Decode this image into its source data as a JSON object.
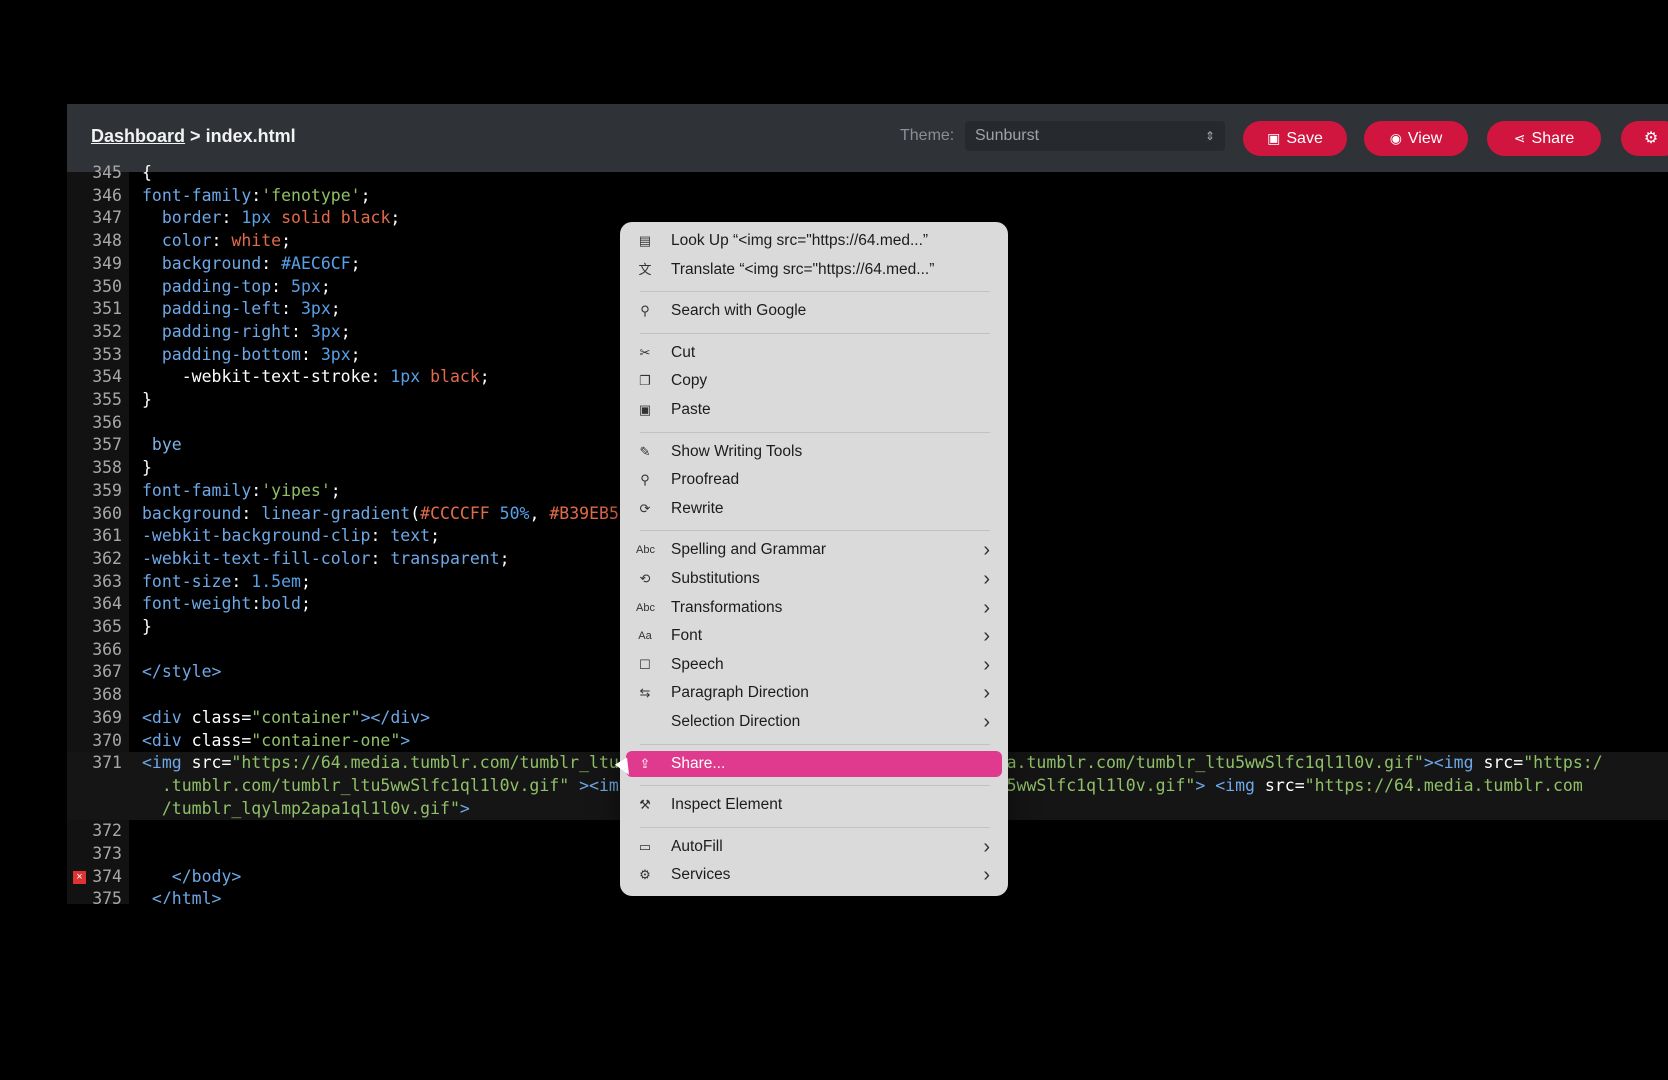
{
  "window": {
    "icons": [
      "feather-icon",
      "circle-icon"
    ]
  },
  "breadcrumb": {
    "link": "Dashboard",
    "sep": ">",
    "current": "index.html"
  },
  "theme": {
    "label": "Theme:",
    "value": "Sunburst"
  },
  "buttons": {
    "save": "Save",
    "view": "View",
    "share": "Share"
  },
  "editor": {
    "lines": [
      {
        "n": "345",
        "segs": [
          [
            "k",
            "{"
          ]
        ]
      },
      {
        "n": "346",
        "segs": [
          [
            "p",
            "font-family"
          ],
          [
            "k",
            ":"
          ],
          [
            "s",
            "'fenotype'"
          ],
          [
            "k",
            ";"
          ]
        ]
      },
      {
        "n": "347",
        "segs": [
          [
            "k",
            "  "
          ],
          [
            "p",
            "border"
          ],
          [
            "k",
            ": "
          ],
          [
            "nb",
            "1px"
          ],
          [
            "k",
            " "
          ],
          [
            "n",
            "solid black"
          ],
          [
            "k",
            ";"
          ]
        ]
      },
      {
        "n": "348",
        "segs": [
          [
            "k",
            "  "
          ],
          [
            "p",
            "color"
          ],
          [
            "k",
            ": "
          ],
          [
            "n",
            "white"
          ],
          [
            "k",
            ";"
          ]
        ]
      },
      {
        "n": "349",
        "segs": [
          [
            "k",
            "  "
          ],
          [
            "p",
            "background"
          ],
          [
            "k",
            ": "
          ],
          [
            "nb",
            "#AEC6CF"
          ],
          [
            "k",
            ";"
          ]
        ]
      },
      {
        "n": "350",
        "segs": [
          [
            "k",
            "  "
          ],
          [
            "p",
            "padding-top"
          ],
          [
            "k",
            ": "
          ],
          [
            "nb",
            "5px"
          ],
          [
            "k",
            ";"
          ]
        ]
      },
      {
        "n": "351",
        "segs": [
          [
            "k",
            "  "
          ],
          [
            "p",
            "padding-left"
          ],
          [
            "k",
            ": "
          ],
          [
            "nb",
            "3px"
          ],
          [
            "k",
            ";"
          ]
        ]
      },
      {
        "n": "352",
        "segs": [
          [
            "k",
            "  "
          ],
          [
            "p",
            "padding-right"
          ],
          [
            "k",
            ": "
          ],
          [
            "nb",
            "3px"
          ],
          [
            "k",
            ";"
          ]
        ]
      },
      {
        "n": "353",
        "segs": [
          [
            "k",
            "  "
          ],
          [
            "p",
            "padding-bottom"
          ],
          [
            "k",
            ": "
          ],
          [
            "nb",
            "3px"
          ],
          [
            "k",
            ";"
          ]
        ]
      },
      {
        "n": "354",
        "segs": [
          [
            "k",
            "    -webkit-text-stroke"
          ],
          [
            "k",
            ": "
          ],
          [
            "nb",
            "1px"
          ],
          [
            "k",
            " "
          ],
          [
            "n",
            "black"
          ],
          [
            "k",
            ";"
          ]
        ]
      },
      {
        "n": "355",
        "segs": [
          [
            "k",
            "}"
          ]
        ]
      },
      {
        "n": "356",
        "segs": []
      },
      {
        "n": "357",
        "segs": [
          [
            "t",
            " bye"
          ]
        ]
      },
      {
        "n": "358",
        "segs": [
          [
            "k",
            "}"
          ]
        ]
      },
      {
        "n": "359",
        "segs": [
          [
            "p",
            "font-family"
          ],
          [
            "k",
            ":"
          ],
          [
            "s",
            "'yipes'"
          ],
          [
            "k",
            ";"
          ]
        ]
      },
      {
        "n": "360",
        "segs": [
          [
            "p",
            "background"
          ],
          [
            "k",
            ": "
          ],
          [
            "p",
            "linear-gradient"
          ],
          [
            "k",
            "("
          ],
          [
            "n",
            "#CCCCFF"
          ],
          [
            "k",
            " "
          ],
          [
            "nb",
            "50%"
          ],
          [
            "k",
            ", "
          ],
          [
            "n",
            "#B39EB5"
          ]
        ]
      },
      {
        "n": "361",
        "segs": [
          [
            "p",
            "-webkit-background-clip"
          ],
          [
            "k",
            ": "
          ],
          [
            "p",
            "text"
          ],
          [
            "k",
            ";"
          ]
        ]
      },
      {
        "n": "362",
        "segs": [
          [
            "p",
            "-webkit-text-fill-color"
          ],
          [
            "k",
            ": "
          ],
          [
            "p",
            "transparent"
          ],
          [
            "k",
            ";"
          ]
        ]
      },
      {
        "n": "363",
        "segs": [
          [
            "p",
            "font-size"
          ],
          [
            "k",
            ": "
          ],
          [
            "nb",
            "1.5em"
          ],
          [
            "k",
            ";"
          ]
        ]
      },
      {
        "n": "364",
        "segs": [
          [
            "p",
            "font-weight"
          ],
          [
            "k",
            ":"
          ],
          [
            "p",
            "bold"
          ],
          [
            "k",
            ";"
          ]
        ]
      },
      {
        "n": "365",
        "segs": [
          [
            "k",
            "}"
          ]
        ]
      },
      {
        "n": "366",
        "segs": []
      },
      {
        "n": "367",
        "segs": [
          [
            "p",
            "</style>"
          ]
        ]
      },
      {
        "n": "368",
        "segs": []
      },
      {
        "n": "369",
        "segs": [
          [
            "p",
            "<div "
          ],
          [
            "k",
            "class"
          ],
          [
            "k",
            "="
          ],
          [
            "s",
            "\"container\""
          ],
          [
            "p",
            "></div>"
          ]
        ]
      },
      {
        "n": "370",
        "segs": [
          [
            "p",
            "<div "
          ],
          [
            "k",
            "class"
          ],
          [
            "k",
            "="
          ],
          [
            "s",
            "\"container-one\""
          ],
          [
            "p",
            ">"
          ]
        ]
      },
      {
        "n": "371",
        "segs": [
          [
            "p",
            "<img "
          ],
          [
            "k",
            "src"
          ],
          [
            "k",
            "="
          ],
          [
            "s",
            "\"https://64.media.tumblr.com/tumblr_ltu"
          ]
        ]
      },
      {
        "n": "",
        "segs": [
          [
            "s",
            "  .tumblr.com/tumblr_ltu5wwSlfc1ql1l0v.gif\" "
          ],
          [
            "p",
            ">"
          ],
          [
            "p",
            "<im"
          ]
        ]
      },
      {
        "n": "",
        "segs": [
          [
            "s",
            "  /tumblr_lqylmp2apa1ql1l0v.gif\""
          ],
          [
            "p",
            ">"
          ]
        ]
      },
      {
        "n": "372",
        "segs": []
      },
      {
        "n": "373",
        "segs": []
      },
      {
        "n": "374",
        "segs": [
          [
            "p",
            "   </body>"
          ]
        ]
      },
      {
        "n": "375",
        "segs": [
          [
            "p",
            " </html>"
          ]
        ]
      }
    ],
    "overflow_right": [
      {
        "row": 26,
        "segs": [
          [
            "s",
            "4.media.tumblr.com/tumblr_ltu5wwSlfc1ql1l0v.gif\""
          ],
          [
            "p",
            "><img "
          ],
          [
            "k",
            "src"
          ],
          [
            "k",
            "="
          ],
          [
            "s",
            "\"https:/"
          ]
        ]
      },
      {
        "row": 27,
        "segs": [
          [
            "s",
            "lr_ltu5wwSlfc1ql1l0v.gif\""
          ],
          [
            "p",
            "> <img "
          ],
          [
            "k",
            "src"
          ],
          [
            "k",
            "="
          ],
          [
            "s",
            "\"https://64.media.tumblr.com"
          ]
        ]
      }
    ]
  },
  "context_menu": {
    "items": [
      {
        "icon": "book-icon",
        "glyph": "▤",
        "label": "Look Up “<img src=\"https://64.med...”"
      },
      {
        "icon": "translate-icon",
        "glyph": "文",
        "label": "Translate “<img src=\"https://64.med...”"
      },
      {
        "sep": true
      },
      {
        "icon": "search-icon",
        "glyph": "⚲",
        "label": "Search with Google"
      },
      {
        "sep": true
      },
      {
        "icon": "scissors-icon",
        "glyph": "✂",
        "label": "Cut"
      },
      {
        "icon": "copy-icon",
        "glyph": "❐",
        "label": "Copy"
      },
      {
        "icon": "paste-icon",
        "glyph": "▣",
        "label": "Paste"
      },
      {
        "sep": true
      },
      {
        "icon": "writing-tools-icon",
        "glyph": "✎",
        "label": "Show Writing Tools"
      },
      {
        "icon": "proofread-icon",
        "glyph": "⚲",
        "label": "Proofread"
      },
      {
        "icon": "rewrite-icon",
        "glyph": "⟳",
        "label": "Rewrite"
      },
      {
        "sep": true
      },
      {
        "icon": "abc-icon",
        "glyph": "Abc",
        "label": "Spelling and Grammar",
        "sub": true
      },
      {
        "icon": "substitutions-icon",
        "glyph": "⟲",
        "label": "Substitutions",
        "sub": true
      },
      {
        "icon": "abc-icon",
        "glyph": "Abc",
        "label": "Transformations",
        "sub": true
      },
      {
        "icon": "font-icon",
        "glyph": "Aa",
        "label": "Font",
        "sub": true
      },
      {
        "icon": "speech-icon",
        "glyph": "☐",
        "label": "Speech",
        "sub": true
      },
      {
        "icon": "direction-icon",
        "glyph": "⇆",
        "label": "Paragraph Direction",
        "sub": true
      },
      {
        "icon": "",
        "glyph": "",
        "label": "Selection Direction",
        "sub": true
      },
      {
        "sep": true
      },
      {
        "icon": "share-icon",
        "glyph": "⇪",
        "label": "Share...",
        "active": true
      },
      {
        "sep": true
      },
      {
        "icon": "inspect-icon",
        "glyph": "⚒",
        "label": "Inspect Element"
      },
      {
        "sep": true
      },
      {
        "icon": "autofill-icon",
        "glyph": "▭",
        "label": "AutoFill",
        "sub": true
      },
      {
        "icon": "services-icon",
        "glyph": "⚙",
        "label": "Services",
        "sub": true
      }
    ]
  }
}
